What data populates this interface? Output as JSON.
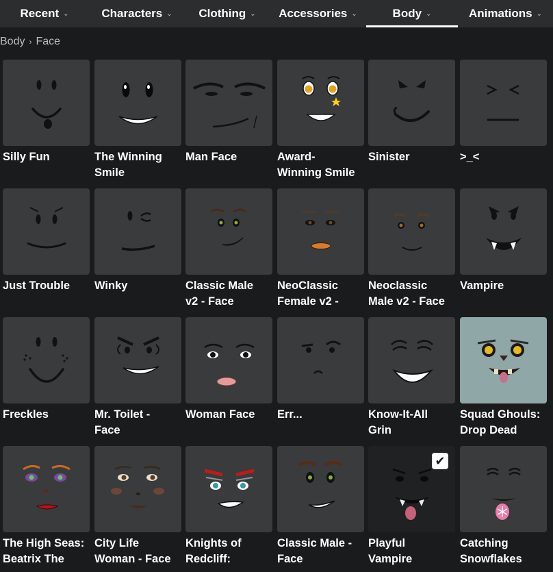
{
  "nav": {
    "tabs": [
      {
        "label": "Recent"
      },
      {
        "label": "Characters"
      },
      {
        "label": "Clothing"
      },
      {
        "label": "Accessories"
      },
      {
        "label": "Body",
        "active": true
      },
      {
        "label": "Animations"
      }
    ]
  },
  "breadcrumb": {
    "root": "Body",
    "current": "Face"
  },
  "items": [
    {
      "name": "Silly Fun",
      "name2": ""
    },
    {
      "name": "The Winning",
      "name2": "Smile"
    },
    {
      "name": "Man Face",
      "name2": ""
    },
    {
      "name": "Award-",
      "name2": "Winning Smile"
    },
    {
      "name": "Sinister",
      "name2": ""
    },
    {
      "name": ">_<",
      "name2": ""
    },
    {
      "name": "Just Trouble",
      "name2": ""
    },
    {
      "name": "Winky",
      "name2": ""
    },
    {
      "name": "Classic Male",
      "name2": "v2 - Face"
    },
    {
      "name": "NeoClassic",
      "name2": "Female v2 -"
    },
    {
      "name": "Neoclassic",
      "name2": "Male v2 - Face"
    },
    {
      "name": "Vampire",
      "name2": ""
    },
    {
      "name": "Freckles",
      "name2": ""
    },
    {
      "name": "Mr. Toilet -",
      "name2": "Face"
    },
    {
      "name": "Woman Face",
      "name2": ""
    },
    {
      "name": "Err...",
      "name2": ""
    },
    {
      "name": "Know-It-All",
      "name2": "Grin"
    },
    {
      "name": "Squad Ghouls:",
      "name2": "Drop Dead"
    },
    {
      "name": "The High Seas:",
      "name2": "Beatrix The"
    },
    {
      "name": "City Life",
      "name2": "Woman - Face"
    },
    {
      "name": "Knights of",
      "name2": "Redcliff:"
    },
    {
      "name": "Classic Male -",
      "name2": "Face"
    },
    {
      "name": "Playful",
      "name2": "Vampire",
      "selected": true
    },
    {
      "name": "Catching",
      "name2": "Snowflakes"
    }
  ],
  "colors": {
    "background": "#191b1d",
    "nav": "#2b2d2f",
    "tile": "#393b3d",
    "tile_teal": "#8fa8a7"
  }
}
